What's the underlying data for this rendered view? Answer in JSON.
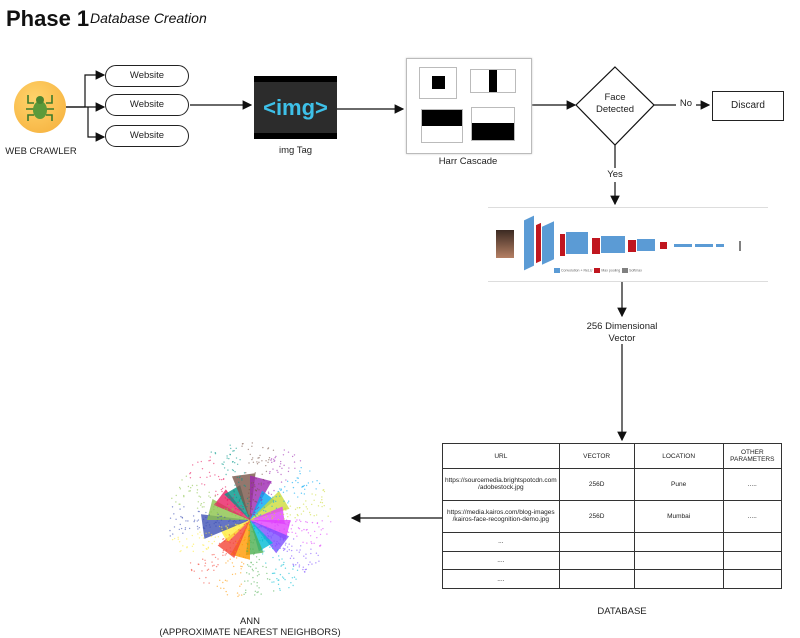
{
  "header": {
    "title": "Phase 1",
    "subtitle": "Database Creation"
  },
  "crawler": {
    "label": "WEB CRAWLER",
    "icon": "spider-icon"
  },
  "websites": [
    {
      "label": "Website"
    },
    {
      "label": "Website"
    },
    {
      "label": "Website"
    }
  ],
  "img_tag": {
    "text": "<img>",
    "label": "img Tag"
  },
  "haar": {
    "label": "Harr Cascade"
  },
  "decision": {
    "line1": "Face",
    "line2": "Detected",
    "no_label": "No",
    "yes_label": "Yes"
  },
  "discard": {
    "label": "Discard"
  },
  "cnn": {
    "legend": [
      "Convolution + ReLU",
      "Max pooling",
      "Softmax"
    ],
    "colors": {
      "conv": "#5b9bd5",
      "pool": "#c0161f",
      "softmax": "#808080"
    }
  },
  "vector": {
    "line1": "256 Dimensional",
    "line2": "Vector"
  },
  "database": {
    "label": "DATABASE",
    "headers": [
      "URL",
      "VECTOR",
      "LOCATION",
      "OTHER PARAMETERS"
    ],
    "rows": [
      [
        "https://sourcemedia.brightspotcdn.com /adobestock.jpg",
        "256D",
        "Pune",
        "....."
      ],
      [
        "https://media.kairos.com/blog-images /kairos-face-recognition-demo.jpg",
        "256D",
        "Mumbai",
        "....."
      ],
      [
        "...",
        "",
        "",
        ""
      ],
      [
        "....",
        "",
        "",
        ""
      ],
      [
        "....",
        "",
        "",
        ""
      ]
    ]
  },
  "ann": {
    "line1": "ANN",
    "line2": "(APPROXIMATE NEAREST NEIGHBORS)"
  }
}
